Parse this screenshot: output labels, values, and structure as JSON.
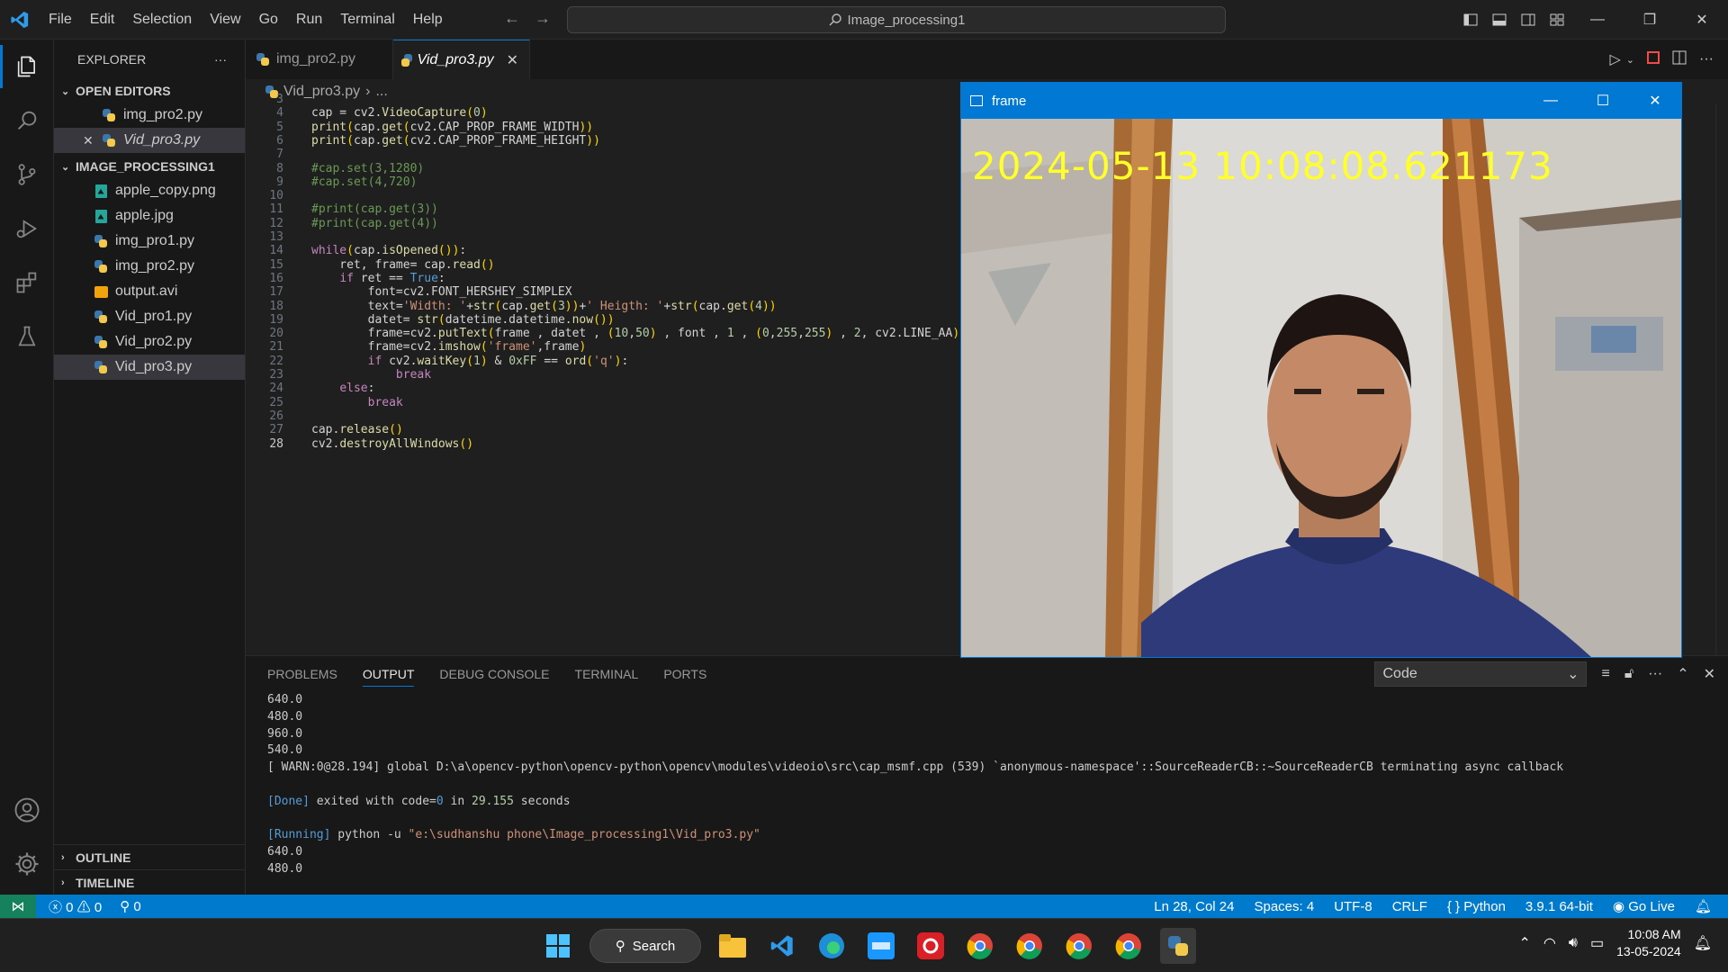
{
  "menu": [
    "File",
    "Edit",
    "Selection",
    "View",
    "Go",
    "Run",
    "Terminal",
    "Help"
  ],
  "command_center": {
    "label": "Image_processing1"
  },
  "explorer": {
    "title": "EXPLORER",
    "open_editors": {
      "label": "OPEN EDITORS",
      "items": [
        "img_pro2.py",
        "Vid_pro3.py"
      ]
    },
    "folder": {
      "label": "IMAGE_PROCESSING1",
      "items": [
        "apple_copy.png",
        "apple.jpg",
        "img_pro1.py",
        "img_pro2.py",
        "output.avi",
        "Vid_pro1.py",
        "Vid_pro2.py",
        "Vid_pro3.py"
      ]
    },
    "outline": "OUTLINE",
    "timeline": "TIMELINE"
  },
  "tabs": [
    "img_pro2.py",
    "Vid_pro3.py"
  ],
  "breadcrumb": {
    "file": "Vid_pro3.py",
    "rest": "..."
  },
  "code_lines": [
    {
      "n": "3",
      "t": ""
    },
    {
      "n": "4",
      "t": "cap = cv2.VideoCapture(0)"
    },
    {
      "n": "5",
      "t": "print(cap.get(cv2.CAP_PROP_FRAME_WIDTH))"
    },
    {
      "n": "6",
      "t": "print(cap.get(cv2.CAP_PROP_FRAME_HEIGHT))"
    },
    {
      "n": "7",
      "t": ""
    },
    {
      "n": "8",
      "t": "#cap.set(3,1280)"
    },
    {
      "n": "9",
      "t": "#cap.set(4,720)"
    },
    {
      "n": "10",
      "t": ""
    },
    {
      "n": "11",
      "t": "#print(cap.get(3))"
    },
    {
      "n": "12",
      "t": "#print(cap.get(4))"
    },
    {
      "n": "13",
      "t": ""
    },
    {
      "n": "14",
      "t": "while(cap.isOpened()):"
    },
    {
      "n": "15",
      "t": "    ret, frame= cap.read()"
    },
    {
      "n": "16",
      "t": "    if ret == True:"
    },
    {
      "n": "17",
      "t": "        font=cv2.FONT_HERSHEY_SIMPLEX"
    },
    {
      "n": "18",
      "t": "        text='Width: '+str(cap.get(3))+' Heigth: '+str(cap.get(4))"
    },
    {
      "n": "19",
      "t": "        datet= str(datetime.datetime.now())"
    },
    {
      "n": "20",
      "t": "        frame=cv2.putText(frame , datet , (10,50) , font , 1 , (0,255,255) , 2, cv2.LINE_AA)"
    },
    {
      "n": "21",
      "t": "        frame=cv2.imshow('frame',frame)"
    },
    {
      "n": "22",
      "t": "        if cv2.waitKey(1) & 0xFF == ord('q'):"
    },
    {
      "n": "23",
      "t": "            break"
    },
    {
      "n": "24",
      "t": "    else:"
    },
    {
      "n": "25",
      "t": "        break"
    },
    {
      "n": "26",
      "t": ""
    },
    {
      "n": "27",
      "t": "cap.release()"
    },
    {
      "n": "28",
      "t": "cv2.destroyAllWindows()"
    }
  ],
  "panel": {
    "tabs": [
      "PROBLEMS",
      "OUTPUT",
      "DEBUG CONSOLE",
      "TERMINAL",
      "PORTS"
    ],
    "active_tab": "OUTPUT",
    "channel": "Code",
    "output": [
      "640.0",
      "480.0",
      "960.0",
      "540.0",
      "[ WARN:0@28.194] global D:\\a\\opencv-python\\opencv-python\\opencv\\modules\\videoio\\src\\cap_msmf.cpp (539) `anonymous-namespace'::SourceReaderCB::~SourceReaderCB terminating async callback",
      "",
      "[Done] exited with code=0 in 29.155 seconds",
      "",
      "[Running] python -u \"e:\\sudhanshu phone\\Image_processing1\\Vid_pro3.py\"",
      "640.0",
      "480.0"
    ]
  },
  "frame_window": {
    "title": "frame",
    "timestamp": "2024-05-13  10:08:08.621173"
  },
  "status": {
    "errors": "0",
    "warnings": "0",
    "ports": "0",
    "position": "Ln 28, Col 24",
    "spaces": "Spaces: 4",
    "encoding": "UTF-8",
    "eol": "CRLF",
    "language": "Python",
    "interpreter": "3.9.1 64-bit",
    "golive": "Go Live"
  },
  "taskbar": {
    "search": "Search",
    "time": "10:08 AM",
    "date": "13-05-2024"
  },
  "colors": {
    "accent": "#0078d4",
    "statusbar": "#007acc",
    "stamp": "#ffff2a"
  }
}
